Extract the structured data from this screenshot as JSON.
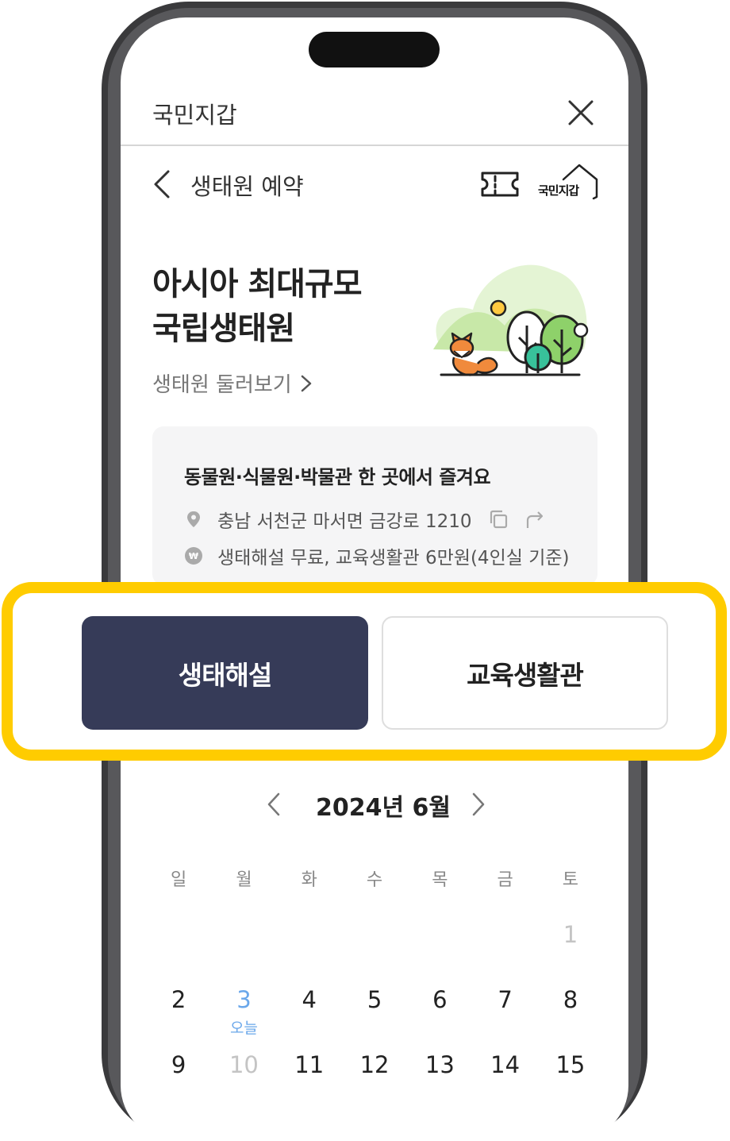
{
  "app": {
    "title": "국민지갑"
  },
  "subheader": {
    "title": "생태원 예약",
    "home_label": "국민지갑"
  },
  "hero": {
    "title_line1": "아시아 최대규모",
    "title_line2": "국립생태원",
    "link_label": "생태원 둘러보기"
  },
  "info": {
    "headline": "동물원·식물원·박물관 한 곳에서 즐겨요",
    "address": "충남 서천군 마서면 금강로 1210",
    "fee": "생태해설 무료, 교육생활관 6만원(4인실 기준)"
  },
  "tabs": [
    {
      "label": "생태해설",
      "selected": true
    },
    {
      "label": "교육생활관",
      "selected": false
    }
  ],
  "calendar": {
    "month_label": "2024년 6월",
    "weekdays": [
      "일",
      "월",
      "화",
      "수",
      "목",
      "금",
      "토"
    ],
    "today_label": "오늘",
    "rows": [
      [
        "",
        "",
        "",
        "",
        "",
        "",
        "1"
      ],
      [
        "2",
        "3",
        "4",
        "5",
        "6",
        "7",
        "8"
      ],
      [
        "9",
        "10",
        "11",
        "12",
        "13",
        "14",
        "15"
      ]
    ]
  },
  "colors": {
    "accent_highlight": "#ffcc00",
    "tab_active_bg": "#363b58",
    "today": "#6aa7ea"
  }
}
